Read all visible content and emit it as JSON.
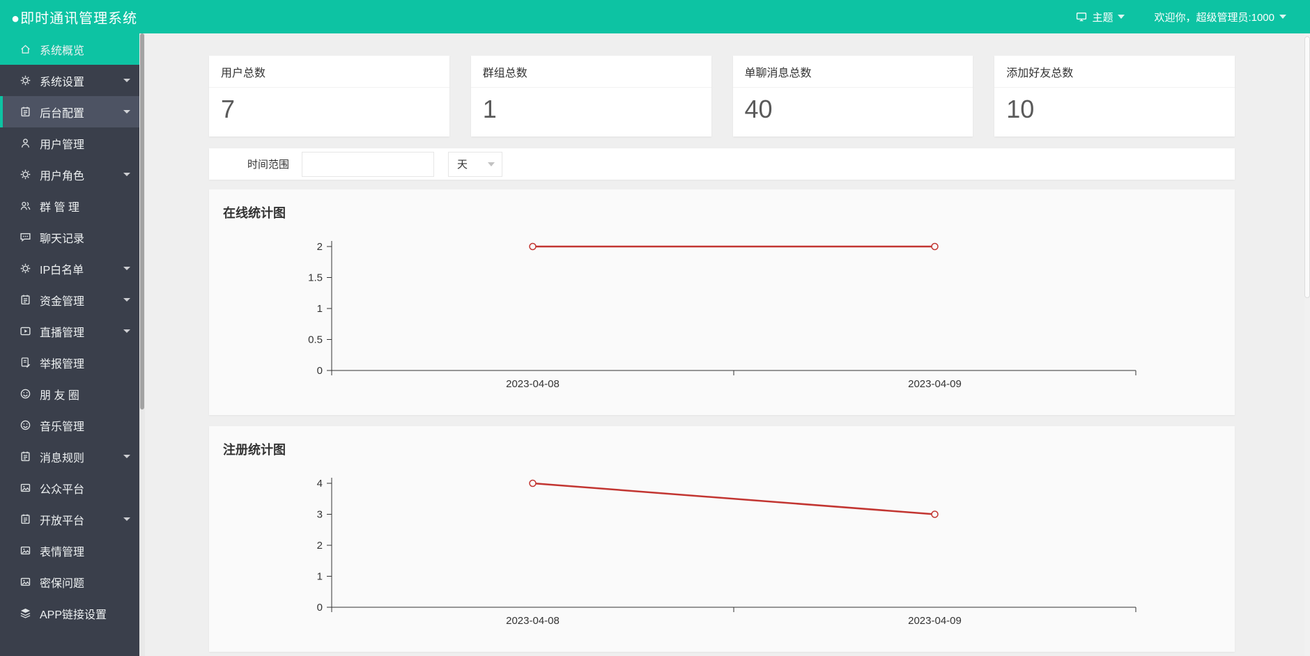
{
  "header": {
    "title": "●即时通讯管理系统",
    "theme_label": "主题",
    "welcome_label": "欢迎你，超级管理员:1000"
  },
  "sidebar": {
    "items": [
      {
        "label": "系统概览",
        "icon": "home-icon",
        "active": true,
        "has_arrow": false
      },
      {
        "label": "系统设置",
        "icon": "gear-icon",
        "has_arrow": true
      },
      {
        "label": "后台配置",
        "icon": "clipboard-icon",
        "open": true,
        "has_arrow": true
      },
      {
        "label": "用户管理",
        "icon": "user-icon",
        "has_arrow": false
      },
      {
        "label": "用户角色",
        "icon": "gear-icon",
        "has_arrow": true
      },
      {
        "label": "群 管 理",
        "icon": "users-icon",
        "has_arrow": false
      },
      {
        "label": "聊天记录",
        "icon": "chat-icon",
        "has_arrow": false
      },
      {
        "label": "IP白名单",
        "icon": "gear-icon",
        "has_arrow": true
      },
      {
        "label": "资金管理",
        "icon": "clipboard-icon",
        "has_arrow": true
      },
      {
        "label": "直播管理",
        "icon": "video-icon",
        "has_arrow": true
      },
      {
        "label": "举报管理",
        "icon": "report-icon",
        "has_arrow": false
      },
      {
        "label": "朋 友 圈",
        "icon": "smile-icon",
        "has_arrow": false
      },
      {
        "label": "音乐管理",
        "icon": "smile-icon",
        "has_arrow": false
      },
      {
        "label": "消息规则",
        "icon": "clipboard-icon",
        "has_arrow": true
      },
      {
        "label": "公众平台",
        "icon": "image-icon",
        "has_arrow": false
      },
      {
        "label": "开放平台",
        "icon": "clipboard-icon",
        "has_arrow": true
      },
      {
        "label": "表情管理",
        "icon": "image-icon",
        "has_arrow": false
      },
      {
        "label": "密保问题",
        "icon": "image-icon",
        "has_arrow": false
      },
      {
        "label": "APP链接设置",
        "icon": "layers-icon",
        "has_arrow": false
      }
    ]
  },
  "stats": [
    {
      "label": "用户总数",
      "value": "7"
    },
    {
      "label": "群组总数",
      "value": "1"
    },
    {
      "label": "单聊消息总数",
      "value": "40"
    },
    {
      "label": "添加好友总数",
      "value": "10"
    }
  ],
  "filter": {
    "label": "时间范围",
    "input_value": "",
    "input_placeholder": "",
    "select_value": "天"
  },
  "colors": {
    "accent_teal": "#0dc3a3",
    "sidebar_bg": "#3a3f4b",
    "chart_line_red": "#c23531"
  },
  "chart_data": [
    {
      "type": "line",
      "title": "在线统计图",
      "categories": [
        "2023-04-08",
        "2023-04-09"
      ],
      "values": [
        2,
        2
      ],
      "ylim": [
        0,
        2
      ],
      "yticks": [
        0,
        0.5,
        1,
        1.5,
        2
      ],
      "xlabel": "",
      "ylabel": "",
      "grid": false,
      "legend": false,
      "line_color": "#c23531",
      "marker": "open-circle"
    },
    {
      "type": "line",
      "title": "注册统计图",
      "categories": [
        "2023-04-08",
        "2023-04-09"
      ],
      "values": [
        4,
        3
      ],
      "ylim": [
        0,
        4
      ],
      "yticks": [
        0,
        1,
        2,
        3,
        4
      ],
      "xlabel": "",
      "ylabel": "",
      "grid": false,
      "legend": false,
      "line_color": "#c23531",
      "marker": "open-circle"
    }
  ]
}
